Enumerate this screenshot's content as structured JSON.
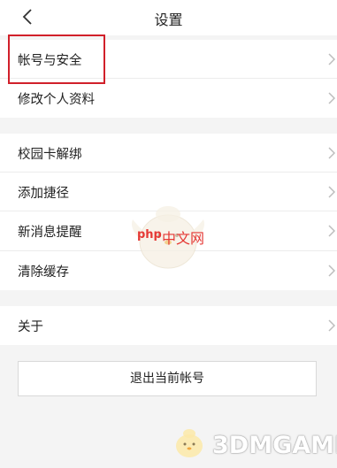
{
  "header": {
    "title": "设置"
  },
  "menu": {
    "account_security": "帐号与安全",
    "edit_profile": "修改个人资料",
    "campus_card_unbind": "校园卡解绑",
    "add_shortcut": "添加捷径",
    "new_message_reminder": "新消息提醒",
    "clear_cache": "清除缓存",
    "about": "关于"
  },
  "logout": {
    "label": "退出当前帐号"
  },
  "watermark": {
    "center_brand": "php",
    "center_site": "中文网",
    "bottom_text": "3DMGAME"
  },
  "colors": {
    "highlight": "#d1202a",
    "page_bg": "#f4f4f4"
  },
  "icons": [
    "chevron-left-icon",
    "chevron-right-icon"
  ]
}
